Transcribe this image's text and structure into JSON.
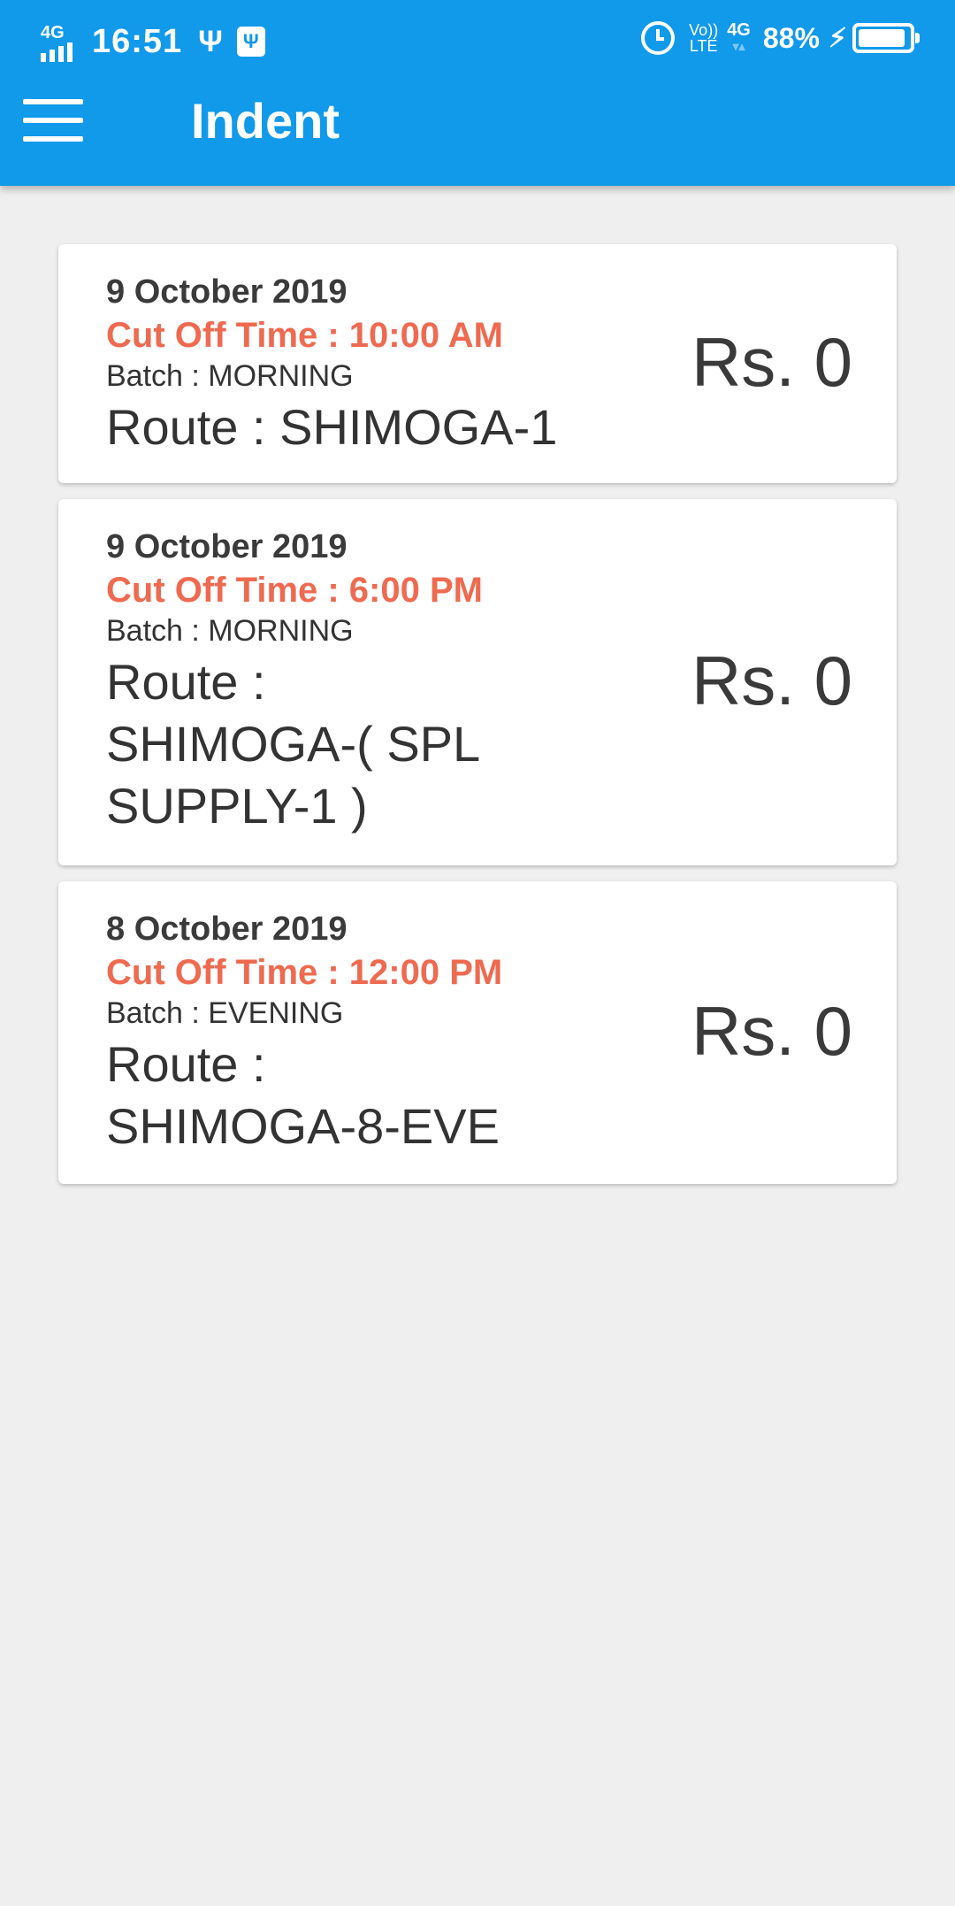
{
  "status_bar": {
    "network_label": "4G",
    "time": "16:51",
    "usb_icon": "usb-icon",
    "usb_debug_icon": "usb-debug-icon",
    "alarm_icon": "alarm-icon",
    "volte_top": "Vo))",
    "volte_bottom": "LTE",
    "data_label": "4G",
    "battery_percent": "88%",
    "charging_icon": "bolt-icon",
    "battery_level": 0.88
  },
  "app_bar": {
    "menu_icon": "hamburger-menu-icon",
    "title": "Indent",
    "color": "#1199ea"
  },
  "indents": [
    {
      "date": "9 October 2019",
      "cutoff": "Cut Off Time : 10:00 AM",
      "batch": "Batch : MORNING",
      "route": "Route : SHIMOGA-1",
      "amount": "Rs. 0"
    },
    {
      "date": "9 October 2019",
      "cutoff": "Cut Off Time : 6:00 PM",
      "batch": "Batch : MORNING",
      "route": "Route : SHIMOGA-( SPL SUPPLY-1 )",
      "amount": "Rs. 0"
    },
    {
      "date": "8 October 2019",
      "cutoff": "Cut Off Time : 12:00 PM",
      "batch": "Batch : EVENING",
      "route": "Route : SHIMOGA-8-EVE",
      "amount": "Rs. 0"
    }
  ],
  "colors": {
    "cutoff": "#ee6a50",
    "background": "#efefef"
  }
}
